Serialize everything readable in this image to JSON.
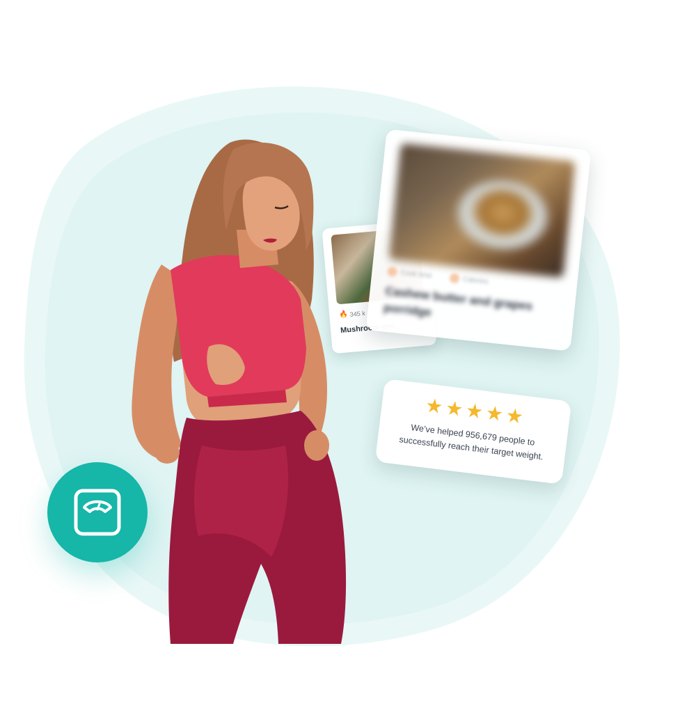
{
  "recipe_card_small": {
    "kcal": "345 k",
    "title": "Mushroom one"
  },
  "recipe_card_big": {
    "meta_1": "Cook time",
    "meta_2": "Calories",
    "title": "Cashew butter and grapes porridge"
  },
  "review": {
    "stars": "★★★★★",
    "rating": 5,
    "text": "We’ve helped 956,679 people to successfully reach their target weight."
  },
  "badge": {
    "icon": "scale-icon"
  },
  "colors": {
    "blob": "#e6f7f6",
    "badge": "#16b6a8",
    "star": "#f5b82e"
  }
}
